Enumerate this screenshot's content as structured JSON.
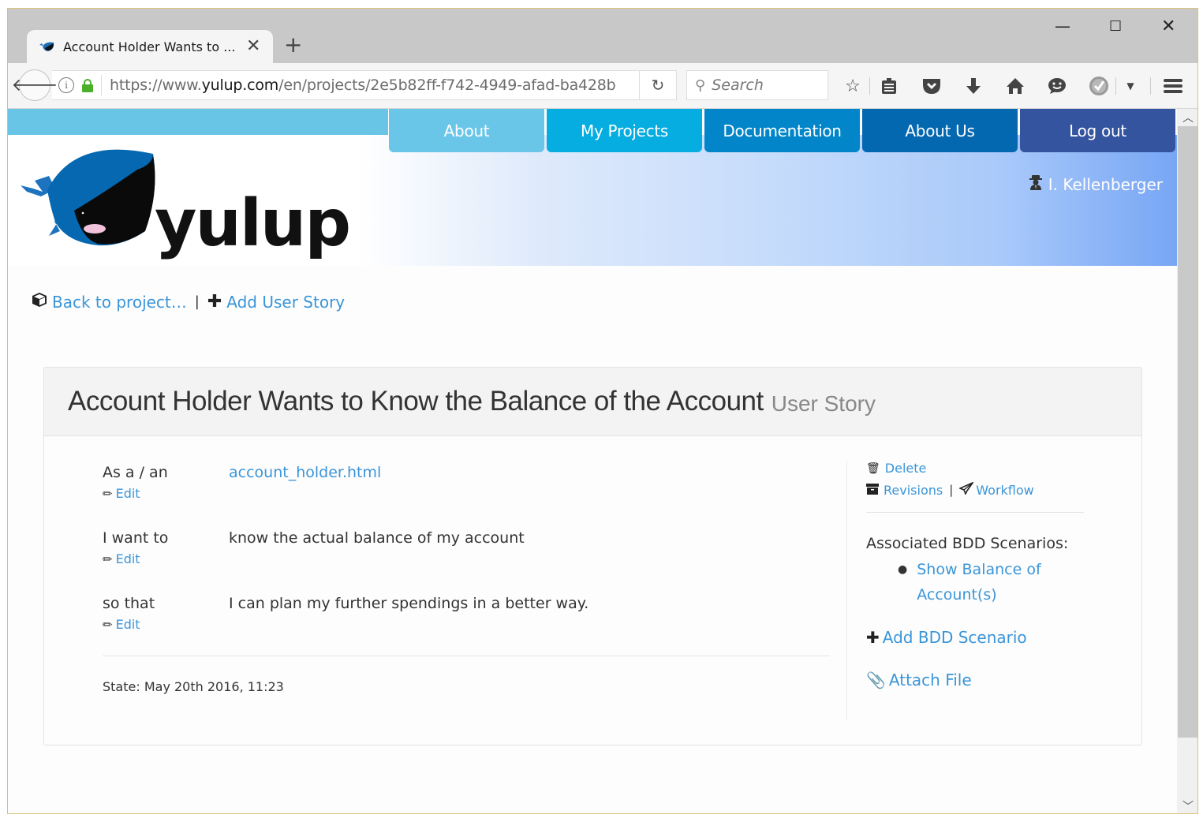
{
  "browser": {
    "tab_title": "Account Holder Wants to ...",
    "url_prefix": "https://www.",
    "url_host": "yulup.com",
    "url_path": "/en/projects/2e5b82ff-f742-4949-afad-ba428b",
    "search_placeholder": "Search",
    "window_controls": {
      "minimize": "—",
      "maximize": "☐",
      "close": "✕"
    },
    "toolbar_icons": [
      "bookmark-star-icon",
      "reading-list-icon",
      "pocket-icon",
      "download-icon",
      "home-icon",
      "chat-icon",
      "extension-check-icon",
      "dropdown-icon",
      "hamburger-menu-icon"
    ]
  },
  "site": {
    "logo_text": "yulup",
    "nav": [
      {
        "label": "About",
        "color": "#6ac6e8"
      },
      {
        "label": "My Projects",
        "color": "#05ade0"
      },
      {
        "label": "Documentation",
        "color": "#0286c9"
      },
      {
        "label": "About Us",
        "color": "#0468b1"
      },
      {
        "label": "Log out",
        "color": "#35549f"
      }
    ],
    "user_name": "I. Kellenberger"
  },
  "actions": {
    "back": "Back to project…",
    "separator": "|",
    "add_user_story": "Add User Story"
  },
  "story": {
    "title": "Account Holder Wants to Know the Balance of the Account",
    "subtitle": "User Story",
    "rows": [
      {
        "label": "As a / an",
        "value": "account_holder.html",
        "edit": "Edit",
        "is_link": true
      },
      {
        "label": "I want to",
        "value": "know the actual balance of my account",
        "edit": "Edit",
        "is_link": false
      },
      {
        "label": "so that",
        "value": "I can plan my further spendings in a better way.",
        "edit": "Edit",
        "is_link": false
      }
    ],
    "state": "State: May 20th 2016, 11:23"
  },
  "sidebar": {
    "delete": "Delete",
    "revisions": "Revisions",
    "separator": "|",
    "workflow": "Workflow",
    "bdd_heading": "Associated BDD Scenarios:",
    "bdd_scenarios": [
      "Show Balance of",
      "Account(s)"
    ],
    "add_bdd": "Add BDD Scenario",
    "attach_file": "Attach File"
  },
  "colors": {
    "link": "#3a95d8",
    "text": "#333333",
    "lock_green": "#4caf2a"
  }
}
